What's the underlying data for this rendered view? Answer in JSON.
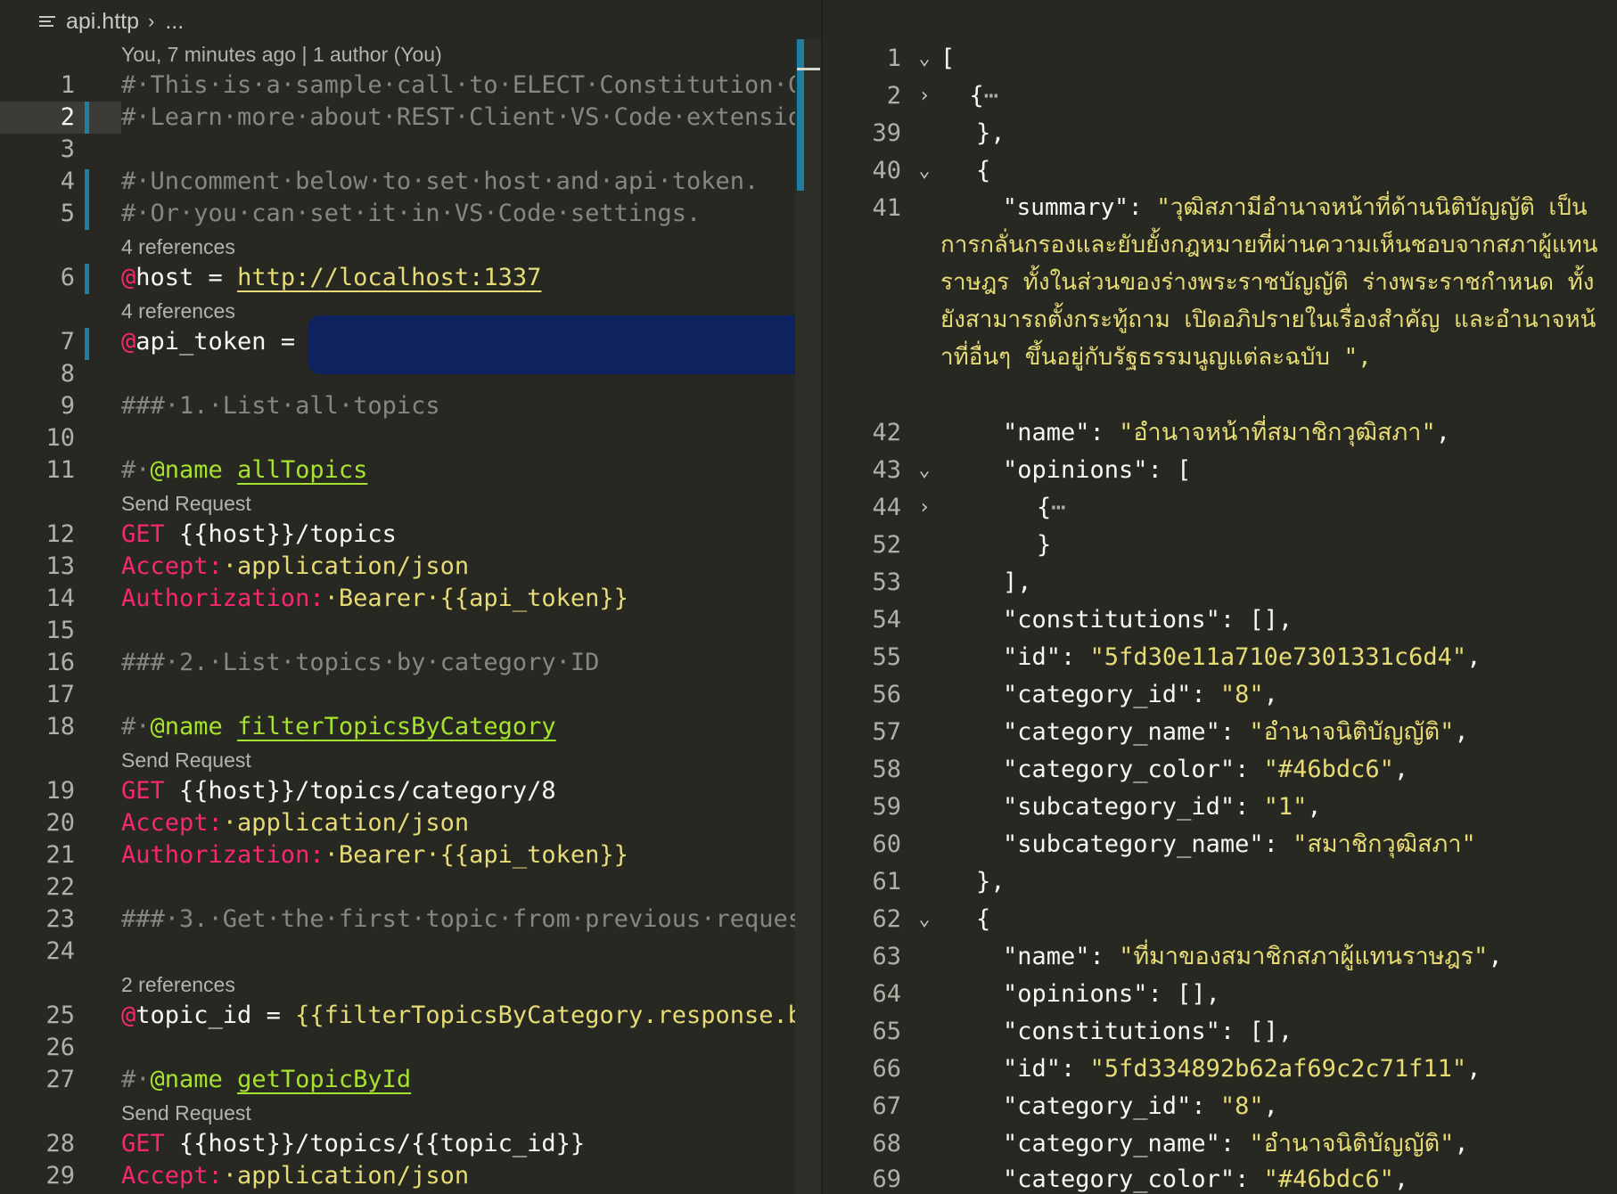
{
  "breadcrumb": {
    "file": "api.http",
    "rest": "..."
  },
  "blame": "You, 7 minutes ago | 1 author (You)",
  "lenses": {
    "ref4a": "4 references",
    "ref4b": "4 references",
    "send1": "Send Request",
    "send2": "Send Request",
    "ref2": "2 references",
    "send3": "Send Request"
  },
  "left_lines": {
    "n1": "1",
    "n2": "2",
    "n3": "3",
    "n4": "4",
    "n5": "5",
    "n6": "6",
    "n7": "7",
    "n8": "8",
    "n9": "9",
    "n10": "10",
    "n11": "11",
    "n12": "12",
    "n13": "13",
    "n14": "14",
    "n15": "15",
    "n16": "16",
    "n17": "17",
    "n18": "18",
    "n19": "19",
    "n20": "20",
    "n21": "21",
    "n22": "22",
    "n23": "23",
    "n24": "24",
    "n25": "25",
    "n26": "26",
    "n27": "27",
    "n28": "28",
    "n29": "29"
  },
  "code": {
    "l1": "#·This·is·a·sample·call·to·ELECT·Constitution·C",
    "l2": "#·Learn·more·about·REST·Client·VS·Code·extensio",
    "l4": "#·Uncomment·below·to·set·host·and·api·token.",
    "l5": "#·Or·you·can·set·it·in·VS·Code·settings.",
    "l6_at": "@",
    "l6_var": "host",
    "l6_eq": " = ",
    "l6_val": "http://localhost:1337",
    "l7_at": "@",
    "l7_var": "api_token",
    "l7_eq": " = ",
    "l9": "###·1.·List·all·topics",
    "l11_hash": "#·",
    "l11_name": "@name",
    "l11_sp": " ",
    "l11_id": "allTopics",
    "l12_method": "GET",
    "l12_url": " {{host}}/topics",
    "l13_h": "Accept:",
    "l13_v": "·application/json",
    "l14_h": "Authorization:",
    "l14_v": "·Bearer·{{api_token}}",
    "l16": "###·2.·List·topics·by·category·ID",
    "l18_hash": "#·",
    "l18_name": "@name",
    "l18_sp": " ",
    "l18_id": "filterTopicsByCategory",
    "l19_method": "GET",
    "l19_url": " {{host}}/topics/category/8",
    "l20_h": "Accept:",
    "l20_v": "·application/json",
    "l21_h": "Authorization:",
    "l21_v": "·Bearer·{{api_token}}",
    "l23": "###·3.·Get·the·first·topic·from·previous·reques",
    "l25_at": "@",
    "l25_var": "topic_id",
    "l25_eq": " = ",
    "l25_val": "{{filterTopicsByCategory.response.b",
    "l27_hash": "#·",
    "l27_name": "@name",
    "l27_sp": " ",
    "l27_id": "getTopicById",
    "l28_method": "GET",
    "l28_url": " {{host}}/topics/{{topic_id}}",
    "l29_h": "Accept:",
    "l29_v": "·application/json"
  },
  "right_lines": {
    "n1": "1",
    "n2": "2",
    "n39": "39",
    "n40": "40",
    "n41": "41",
    "n42": "42",
    "n43": "43",
    "n44": "44",
    "n52": "52",
    "n53": "53",
    "n54": "54",
    "n55": "55",
    "n56": "56",
    "n57": "57",
    "n58": "58",
    "n59": "59",
    "n60": "60",
    "n61": "61",
    "n62": "62",
    "n63": "63",
    "n64": "64",
    "n65": "65",
    "n66": "66",
    "n67": "67",
    "n68": "68",
    "n69": "69"
  },
  "json": {
    "r1": "[",
    "r2_brace": "{",
    "r2_dots": "⋯",
    "r39": "},",
    "r40": "{",
    "r41_key": "\"summary\"",
    "r41_colon": ": ",
    "r41_val": "\"วุฒิสภามีอำนาจหน้าที่ด้านนิติบัญญัติ เป็นการกลั่นกรองและยับยั้งกฎหมายที่ผ่านความเห็นชอบจากสภาผู้แทนราษฎร ทั้งในส่วนของร่างพระราชบัญญัติ ร่างพระราชกำหนด ทั้งยังสามารถตั้งกระทู้ถาม เปิดอภิปรายในเรื่องสำคัญ และอำนาจหน้าที่อื่นๆ ขึ้นอยู่กับรัฐธรรมนูญแต่ละฉบับ \",",
    "r42_key": "\"name\"",
    "r42_val": "\"อำนาจหน้าที่สมาชิกวุฒิสภา\"",
    "r43_key": "\"opinions\"",
    "r43_rest": ": [",
    "r44_brace": "{",
    "r44_dots": "⋯",
    "r52": "}",
    "r53": "],",
    "r54_key": "\"constitutions\"",
    "r54_rest": ": [],",
    "r55_key": "\"id\"",
    "r55_val": "\"5fd30e11a710e7301331c6d4\"",
    "r56_key": "\"category_id\"",
    "r56_val": "\"8\"",
    "r57_key": "\"category_name\"",
    "r57_val": "\"อำนาจนิติบัญญัติ\"",
    "r58_key": "\"category_color\"",
    "r58_val": "\"#46bdc6\"",
    "r59_key": "\"subcategory_id\"",
    "r59_val": "\"1\"",
    "r60_key": "\"subcategory_name\"",
    "r60_val": "\"สมาชิกวุฒิสภา\"",
    "r61": "},",
    "r62": "{",
    "r63_key": "\"name\"",
    "r63_val": "\"ที่มาของสมาชิกสภาผู้แทนราษฎร\"",
    "r64_key": "\"opinions\"",
    "r64_rest": ": [],",
    "r65_key": "\"constitutions\"",
    "r65_rest": ": [],",
    "r66_key": "\"id\"",
    "r66_val": "\"5fd334892b62af69c2c71f11\"",
    "r67_key": "\"category_id\"",
    "r67_val": "\"8\"",
    "r68_key": "\"category_name\"",
    "r68_val": "\"อำนาจนิติบัญญัติ\"",
    "r69_key": "\"category_color\"",
    "r69_val": "\"#46bdc6\""
  },
  "colors": {
    "background": "#272822",
    "keyword_pink": "#f92672",
    "string_yellow": "#e6db74",
    "name_green": "#a6e22e",
    "git_bar_blue": "#1f7fa0",
    "redaction": "#0e2260"
  },
  "icons": {
    "file": "lines-file-icon",
    "breadcrumb_separator": "chevron-right-icon",
    "fold_open": "chevron-down-icon",
    "fold_closed": "chevron-right-icon"
  }
}
